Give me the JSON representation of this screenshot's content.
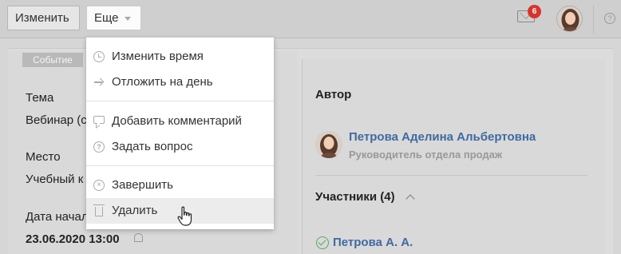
{
  "toolbar": {
    "edit_label": "Изменить",
    "more_label": "Еще",
    "mail_badge_count": "6",
    "help_glyph": "?"
  },
  "event": {
    "tag": "Событие",
    "topic_label": "Тема",
    "topic_value": "Вебинар (с",
    "place_label": "Место",
    "place_value": "Учебный к",
    "start_label": "Дата начал",
    "start_value": "23.06.2020 13:00"
  },
  "author": {
    "section_title": "Автор",
    "name": "Петрова Аделина Альбертовна",
    "role": "Руководитель отдела продаж"
  },
  "participants": {
    "title": "Участники (4)",
    "items": [
      {
        "name": "Петрова А. А."
      }
    ]
  },
  "menu": {
    "items": [
      {
        "label": "Изменить время",
        "icon": "clock-icon"
      },
      {
        "label": "Отложить на день",
        "icon": "arrow-right-icon"
      },
      {
        "label": "Добавить комментарий",
        "icon": "comment-icon"
      },
      {
        "label": "Задать вопрос",
        "icon": "question-icon"
      },
      {
        "label": "Завершить",
        "icon": "close-circle-icon"
      },
      {
        "label": "Удалить",
        "icon": "trash-icon"
      }
    ],
    "question_glyph": "?",
    "close_glyph": "×"
  },
  "colors": {
    "link": "#3f6aa0",
    "badge": "#d9342b",
    "check": "#58a868"
  }
}
